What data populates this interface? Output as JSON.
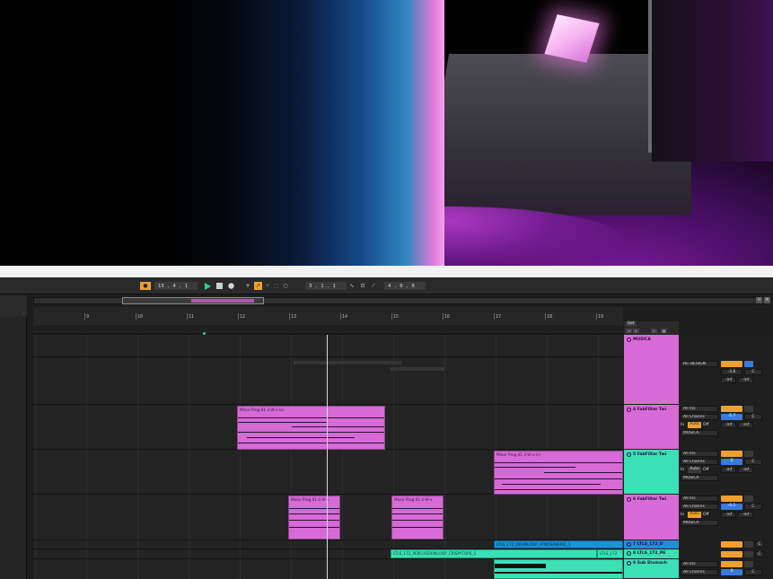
{
  "transport": {
    "metro_label": "●",
    "position": "13 . 4 . 1",
    "play_icon": "play-icon",
    "stop_icon": "stop-icon",
    "record_icon": "record-icon",
    "loop_start": "3 . 1 . 1",
    "loop_length": "4 . 0 . 0"
  },
  "ruler": {
    "bars": [
      "9",
      "10",
      "11",
      "12",
      "13",
      "14",
      "15",
      "16",
      "17",
      "18",
      "19"
    ]
  },
  "set_label": "Set",
  "tracks": [
    {
      "name": "MUSICA",
      "color": "#d66bd6",
      "input": "RE-DESIGN",
      "volume": "-3.6",
      "pan": "C",
      "peak_l": "-inf",
      "peak_r": "-inf"
    },
    {
      "name": "4 FabFilter Twi",
      "color": "#d66bd6",
      "input": "All Ins",
      "channel": "All Channs",
      "monitor_in": "In",
      "monitor_auto": "Auto",
      "monitor_off": "Off",
      "output": "MUSICA",
      "volume": "-5.7",
      "pan": "C",
      "peak_l": "-inf",
      "peak_r": "-inf"
    },
    {
      "name": "5 FabFilter Twi",
      "color": "#3be0b4",
      "input": "All Ins",
      "channel": "All Channs",
      "monitor_in": "In",
      "monitor_auto": "Auto",
      "monitor_off": "Off",
      "output": "MUSICA",
      "volume": "0",
      "pan": "C",
      "peak_l": "-inf",
      "peak_r": "-inf"
    },
    {
      "name": "6 FabFilter Twi",
      "color": "#d66bd6",
      "input": "All Ins",
      "channel": "All Channs",
      "monitor_in": "In",
      "monitor_auto": "Auto",
      "monitor_off": "Off",
      "output": "MUSICA",
      "volume": "-0.1",
      "pan": "C",
      "peak_l": "-inf",
      "peak_r": "-inf"
    },
    {
      "name": "7 LTLS_172_D",
      "color": "#1f8fd8",
      "volume": "",
      "pan": "C"
    },
    {
      "name": "8 LTLS_172_PE",
      "color": "#3be0b4",
      "pan": "C"
    },
    {
      "name": "9 Sub Stomach",
      "color": "#3be0b4",
      "input": "All Ins",
      "channel": "All Channs",
      "volume": "0",
      "pan": "C"
    }
  ],
  "clips": [
    {
      "name": "Minor Prog 01 (i-VI-v-iv)"
    },
    {
      "name": "Minor Prog 01 (i-VI-v-iv)"
    },
    {
      "name": "Minor Prog 01 (i-VI-v"
    },
    {
      "name": "Minor Prog 01 (i-VI-v"
    },
    {
      "name": "LTLS_172_DRUMLOOP_ATMOSPHERIC_1"
    },
    {
      "name": "LTLS_172_PERCUSSIONLOOP_CRISPYTOPS_1"
    },
    {
      "name": "LTLS_172"
    }
  ],
  "colors": {
    "pink": "#d66bd6",
    "teal": "#3be0b4",
    "blue": "#1f8fd8",
    "orange": "#f0a030",
    "play_green": "#2fd08a"
  }
}
